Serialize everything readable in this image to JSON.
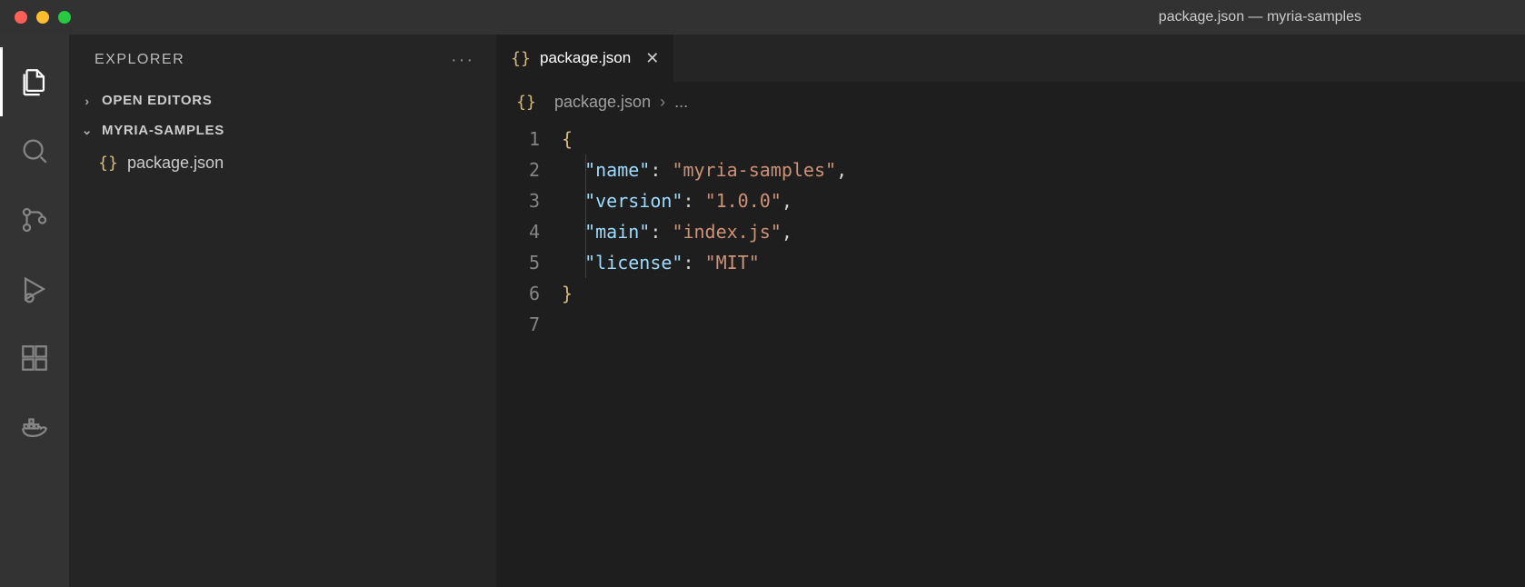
{
  "window": {
    "title": "package.json — myria-samples"
  },
  "activity_bar": {
    "items": [
      {
        "name": "explorer",
        "active": true
      },
      {
        "name": "search",
        "active": false
      },
      {
        "name": "source-control",
        "active": false
      },
      {
        "name": "run-debug",
        "active": false
      },
      {
        "name": "extensions",
        "active": false
      },
      {
        "name": "docker",
        "active": false
      }
    ]
  },
  "sidebar": {
    "title": "EXPLORER",
    "sections": {
      "open_editors": {
        "label": "OPEN EDITORS",
        "expanded": false
      },
      "workspace": {
        "label": "MYRIA-SAMPLES",
        "expanded": true,
        "files": [
          {
            "name": "package.json",
            "icon": "braces"
          }
        ]
      }
    }
  },
  "tabs": [
    {
      "name": "package.json",
      "icon": "braces",
      "active": true,
      "dirty": false
    }
  ],
  "breadcrumbs": {
    "file": "package.json",
    "tail": "..."
  },
  "editor": {
    "language": "json",
    "line_numbers": [
      "1",
      "2",
      "3",
      "4",
      "5",
      "6",
      "7"
    ],
    "lines": [
      [
        {
          "t": "brace",
          "v": "{"
        }
      ],
      [
        {
          "t": "indent"
        },
        {
          "t": "key",
          "v": "\"name\""
        },
        {
          "t": "punct",
          "v": ": "
        },
        {
          "t": "string",
          "v": "\"myria-samples\""
        },
        {
          "t": "punct",
          "v": ","
        }
      ],
      [
        {
          "t": "indent"
        },
        {
          "t": "key",
          "v": "\"version\""
        },
        {
          "t": "punct",
          "v": ": "
        },
        {
          "t": "string",
          "v": "\"1.0.0\""
        },
        {
          "t": "punct",
          "v": ","
        }
      ],
      [
        {
          "t": "indent"
        },
        {
          "t": "key",
          "v": "\"main\""
        },
        {
          "t": "punct",
          "v": ": "
        },
        {
          "t": "string",
          "v": "\"index.js\""
        },
        {
          "t": "punct",
          "v": ","
        }
      ],
      [
        {
          "t": "indent"
        },
        {
          "t": "key",
          "v": "\"license\""
        },
        {
          "t": "punct",
          "v": ": "
        },
        {
          "t": "string",
          "v": "\"MIT\""
        }
      ],
      [
        {
          "t": "brace",
          "v": "}"
        }
      ],
      []
    ],
    "current_line": 7,
    "json_content": {
      "name": "myria-samples",
      "version": "1.0.0",
      "main": "index.js",
      "license": "MIT"
    }
  }
}
